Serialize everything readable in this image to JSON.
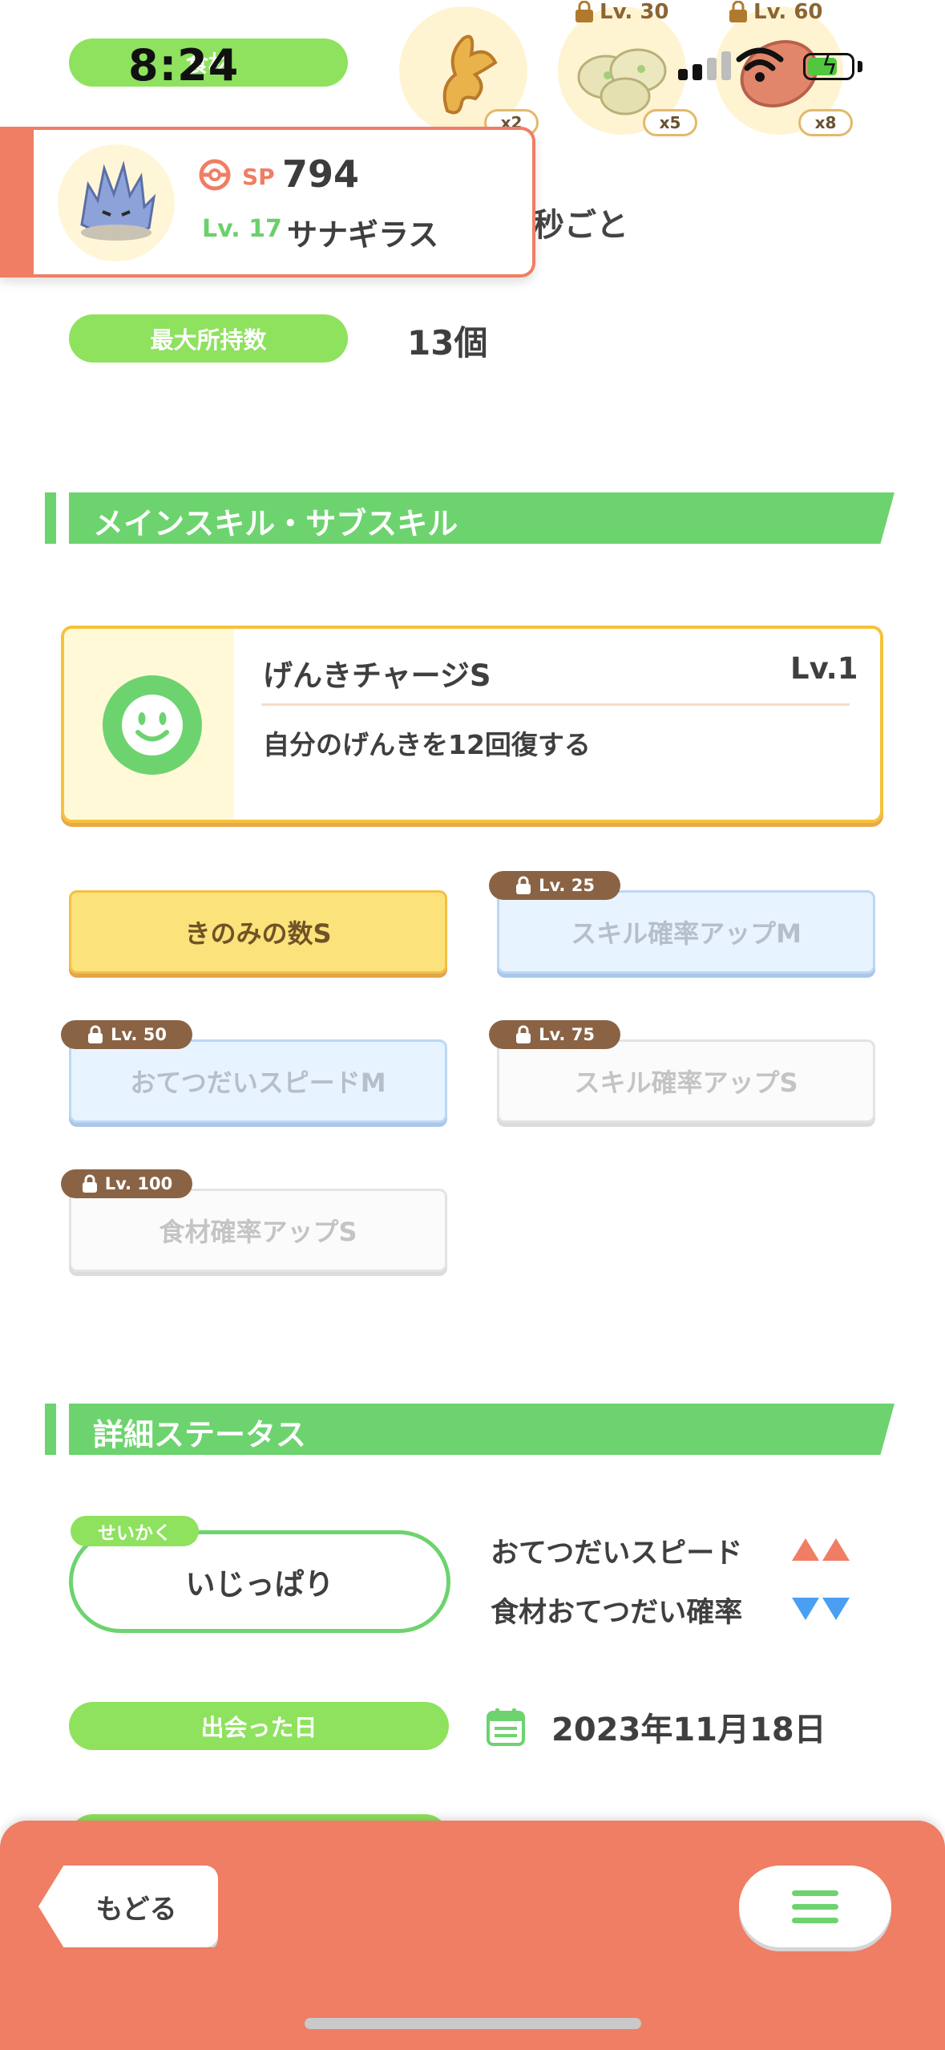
{
  "status_bar": {
    "time": "8:24"
  },
  "top_row": {
    "pill_text": "食材",
    "ingredients": [
      {
        "count": "x2",
        "lock_level": ""
      },
      {
        "count": "x5",
        "lock_level": "Lv. 30"
      },
      {
        "count": "x8",
        "lock_level": "Lv. 60"
      }
    ]
  },
  "pokemon_card": {
    "sp_label": "SP",
    "sp_value": "794",
    "level": "Lv. 17",
    "name": "サナギラス"
  },
  "behind_text": "秒ごと",
  "max_carry": {
    "label": "最大所持数",
    "value": "13個"
  },
  "section_skills": {
    "title": "メインスキル・サブスキル"
  },
  "main_skill": {
    "name": "げんきチャージS",
    "level": "Lv.1",
    "description": "自分のげんきを12回復する"
  },
  "sub_skills": [
    {
      "label": "きのみの数S",
      "lock": ""
    },
    {
      "label": "スキル確率アップM",
      "lock": "Lv. 25"
    },
    {
      "label": "おてつだいスピードM",
      "lock": "Lv. 50"
    },
    {
      "label": "スキル確率アップS",
      "lock": "Lv. 75"
    },
    {
      "label": "食材確率アップS",
      "lock": "Lv. 100"
    }
  ],
  "section_status": {
    "title": "詳細ステータス"
  },
  "nature": {
    "tag": "せいかく",
    "value": "いじっぱり",
    "up_stat": "おてつだいスピード",
    "down_stat": "食材おてつだい確率"
  },
  "met_date": {
    "label": "出会った日",
    "value": "2023年11月18日"
  },
  "bottom_bar": {
    "back_label": "もどる"
  },
  "colors": {
    "accent_green": "#6dd36f",
    "pill_green": "#8ee25e",
    "coral": "#ef7e64",
    "gold": "#f5c23a",
    "up_arrow": "#ef7e64",
    "down_arrow": "#4a9ff2"
  },
  "icons": {
    "signal": "cellular-signal-icon",
    "wifi": "wifi-icon",
    "battery": "battery-charging-icon",
    "sp": "pokeball-icon",
    "main_skill": "smile-face-icon",
    "lock": "lock-icon",
    "calendar": "calendar-icon",
    "menu": "hamburger-menu-icon"
  }
}
